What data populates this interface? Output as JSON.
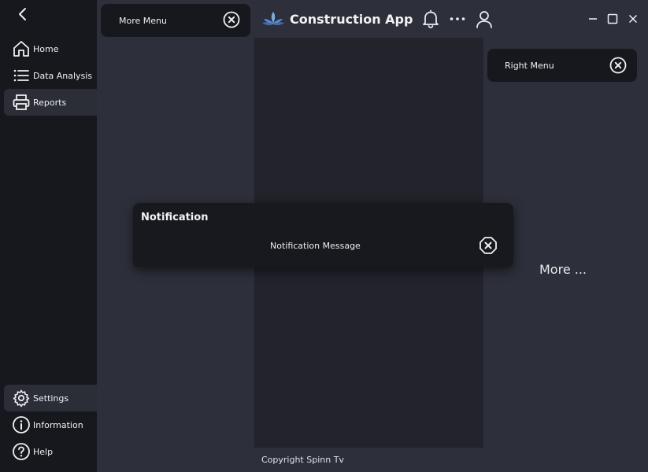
{
  "app": {
    "title": "Construction App"
  },
  "sidebar": {
    "top_items": [
      {
        "label": "Home",
        "icon": "home-icon"
      },
      {
        "label": "Data Analysis",
        "icon": "list-icon"
      },
      {
        "label": "Reports",
        "icon": "printer-icon",
        "active": true
      }
    ],
    "bottom_items": [
      {
        "label": "Settings",
        "icon": "gear-icon",
        "active": true
      },
      {
        "label": "Information",
        "icon": "info-icon"
      },
      {
        "label": "Help",
        "icon": "help-icon"
      }
    ]
  },
  "more_menu": {
    "label": "More Menu"
  },
  "right_menu": {
    "label": "Right Menu"
  },
  "right_panel": {
    "more_text": "More ..."
  },
  "notification": {
    "title": "Notification",
    "message": "Notification Message"
  },
  "footer": {
    "copyright": "Copyright Spinn Tv"
  },
  "colors": {
    "sidebar_bg": "#17181d",
    "page_bg": "#2d2f3a",
    "content_bg": "#22232b",
    "accent_logo": "#5b8fd0"
  }
}
